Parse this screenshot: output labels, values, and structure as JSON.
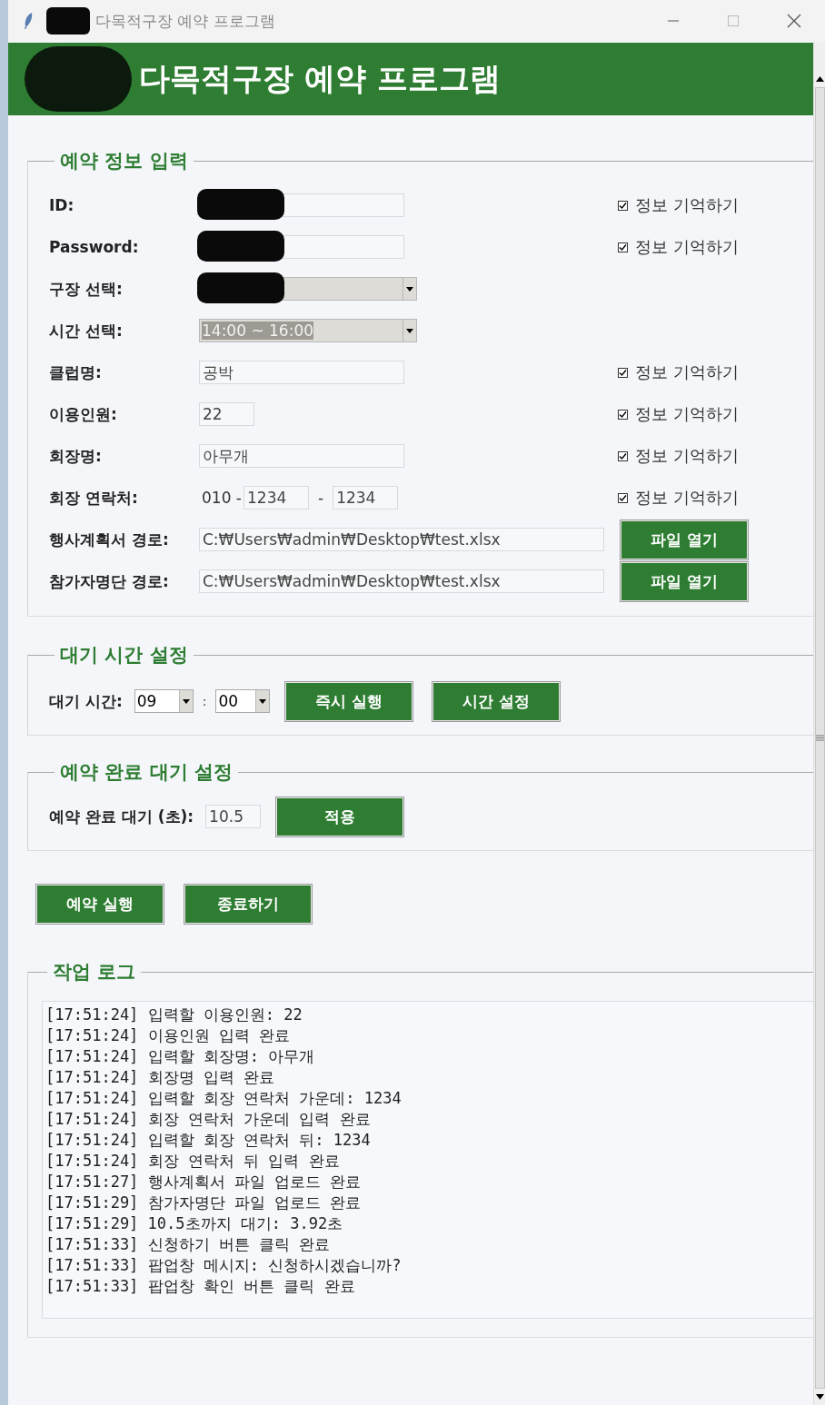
{
  "window": {
    "title": "다목적구장 예약 프로그램"
  },
  "header": {
    "title": "다목적구장 예약 프로그램"
  },
  "reservation": {
    "legend": "예약 정보 입력",
    "rows": [
      {
        "kind": "text",
        "label": "ID:",
        "redacted": true,
        "remember": {
          "label": "정보 기억하기",
          "checked": true
        }
      },
      {
        "kind": "text",
        "label": "Password:",
        "redacted": true,
        "remember": {
          "label": "정보 기억하기",
          "checked": true
        }
      },
      {
        "kind": "combo",
        "label": "구장 선택:",
        "redacted": true
      },
      {
        "kind": "combo",
        "label": "시간 선택:",
        "value": "14:00 ~ 16:00",
        "highlighted": true
      },
      {
        "kind": "text",
        "label": "클럽명:",
        "value": "공박",
        "remember": {
          "label": "정보 기억하기",
          "checked": true
        }
      },
      {
        "kind": "short",
        "label": "이용인원:",
        "value": "22",
        "remember": {
          "label": "정보 기억하기",
          "checked": true
        }
      },
      {
        "kind": "text",
        "label": "회장명:",
        "value": "아무개",
        "remember": {
          "label": "정보 기억하기",
          "checked": true
        }
      },
      {
        "kind": "phone",
        "label": "회장 연락처:",
        "prefix": "010 -",
        "parts": [
          "1234",
          "1234"
        ],
        "separator": "-",
        "remember": {
          "label": "정보 기억하기",
          "checked": true
        }
      },
      {
        "kind": "path",
        "label": "행사계획서 경로:",
        "value": "C:₩Users₩admin₩Desktop₩test.xlsx",
        "button": "파일 열기"
      },
      {
        "kind": "path",
        "label": "참가자명단 경로:",
        "value": "C:₩Users₩admin₩Desktop₩test.xlsx",
        "button": "파일 열기"
      }
    ]
  },
  "wait": {
    "legend": "대기 시간 설정",
    "label": "대기 시간:",
    "hour": "09",
    "separator": ":",
    "minute": "00",
    "buttons": [
      "즉시 실행",
      "시간 설정"
    ]
  },
  "completion": {
    "legend": "예약 완료 대기 설정",
    "label": "예약 완료 대기 (초):",
    "value": "10.5",
    "button": "적용"
  },
  "actions": [
    "예약 실행",
    "종료하기"
  ],
  "log": {
    "legend": "작업 로그",
    "lines": [
      "[17:51:24] 입력할 이용인원: 22",
      "[17:51:24] 이용인원 입력 완료",
      "[17:51:24] 입력할 회장명: 아무개",
      "[17:51:24] 회장명 입력 완료",
      "[17:51:24] 입력할 회장 연락처 가운데: 1234",
      "[17:51:24] 회장 연락처 가운데 입력 완료",
      "[17:51:24] 입력할 회장 연락처 뒤: 1234",
      "[17:51:24] 회장 연락처 뒤 입력 완료",
      "[17:51:27] 행사계획서 파일 업로드 완료",
      "[17:51:29] 참가자명단 파일 업로드 완료",
      "[17:51:29] 10.5초까지 대기: 3.92초",
      "[17:51:33] 신청하기 버튼 클릭 완료",
      "[17:51:33] 팝업창 메시지: 신청하시겠습니까?",
      "[17:51:33] 팝업창 확인 버튼 클릭 완료"
    ]
  }
}
